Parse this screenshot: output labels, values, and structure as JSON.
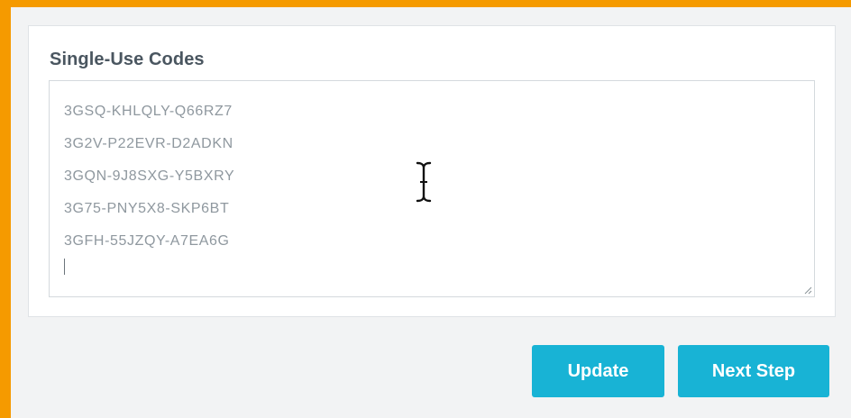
{
  "form": {
    "codes_label": "Single-Use Codes",
    "codes": [
      "3GSQ-KHLQLY-Q66RZ7",
      "3G2V-P22EVR-D2ADKN",
      "3GQN-9J8SXG-Y5BXRY",
      "3G75-PNY5X8-SKP6BT",
      "3GFH-55JZQY-A7EA6G"
    ]
  },
  "actions": {
    "update_label": "Update",
    "next_step_label": "Next Step"
  },
  "colors": {
    "frame_accent": "#f59a00",
    "button_primary": "#18b3d5",
    "label_text": "#4a5660",
    "code_text": "#8f989f"
  },
  "icons": {
    "mouse_cursor": "ibeam-cursor-icon",
    "resize": "resize-grip-icon"
  }
}
